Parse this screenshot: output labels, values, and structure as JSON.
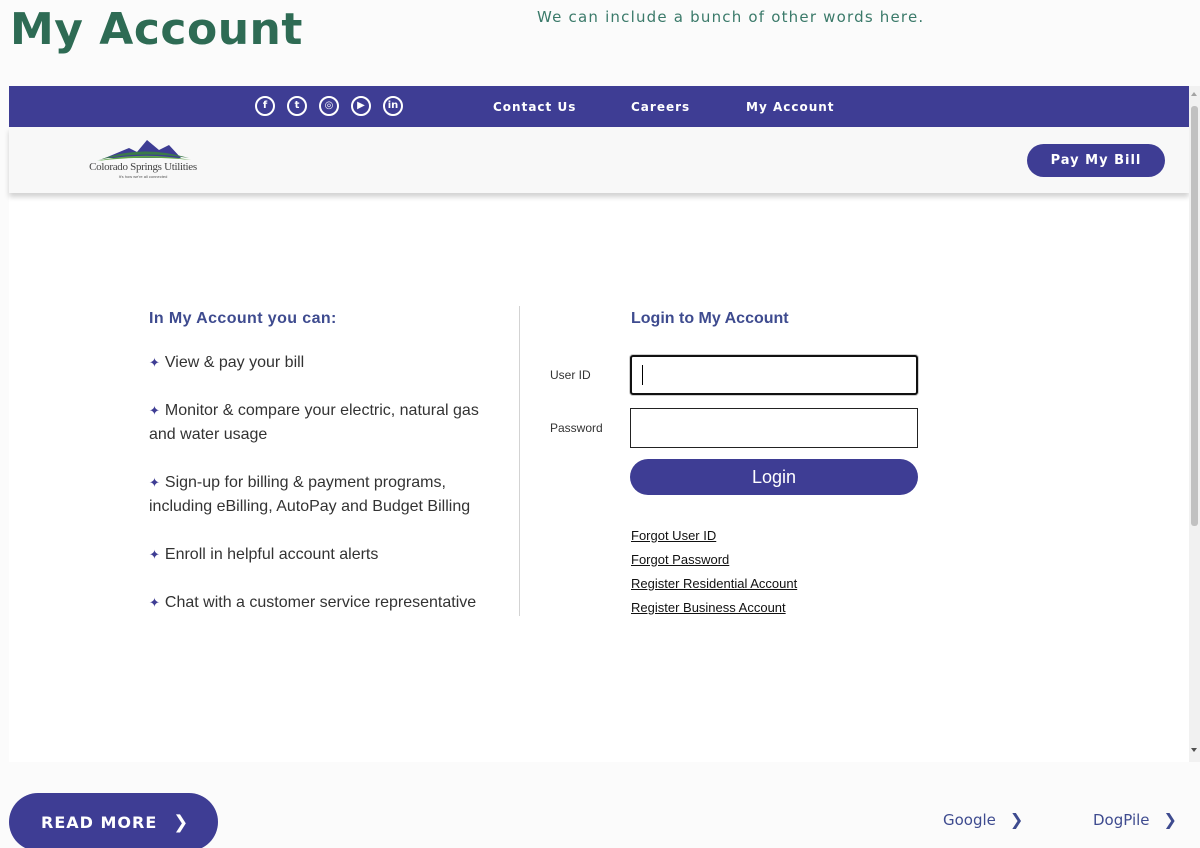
{
  "page": {
    "title": "My Account",
    "tagline": "We can include a bunch of other words here."
  },
  "nav": {
    "social_icons": [
      {
        "name": "facebook-icon",
        "glyph": "f"
      },
      {
        "name": "twitter-icon",
        "glyph": "t"
      },
      {
        "name": "instagram-icon",
        "glyph": "◎"
      },
      {
        "name": "youtube-icon",
        "glyph": "▶"
      },
      {
        "name": "linkedin-icon",
        "glyph": "in"
      }
    ],
    "contact": "Contact Us",
    "careers": "Careers",
    "account": "My Account"
  },
  "header": {
    "logo_name": "Colorado Springs Utilities",
    "logo_sub": "It's how we're all connected",
    "pay_label": "Pay My Bill"
  },
  "features": {
    "heading": "In My Account you can:",
    "items": [
      "View & pay your bill",
      "Monitor & compare your electric, natural gas and water usage",
      "Sign-up for billing & payment programs, including eBilling, AutoPay and Budget Billing",
      "Enroll in helpful account alerts",
      "Chat with a customer service representative"
    ]
  },
  "login": {
    "heading": "Login to My Account",
    "user_label": "User ID",
    "user_value": "",
    "password_label": "Password",
    "password_value": "",
    "button": "Login",
    "links": {
      "forgot_user": "Forgot User ID",
      "forgot_password": "Forgot Password",
      "register_residential": "Register Residential Account",
      "register_business": "Register Business Account"
    }
  },
  "footer": {
    "read_more": "READ MORE",
    "google": "Google",
    "dogpile": "DogPile"
  },
  "colors": {
    "brand": "#3e3d94",
    "title_green": "#2e6b54",
    "heading_blue": "#3e4b8f"
  }
}
